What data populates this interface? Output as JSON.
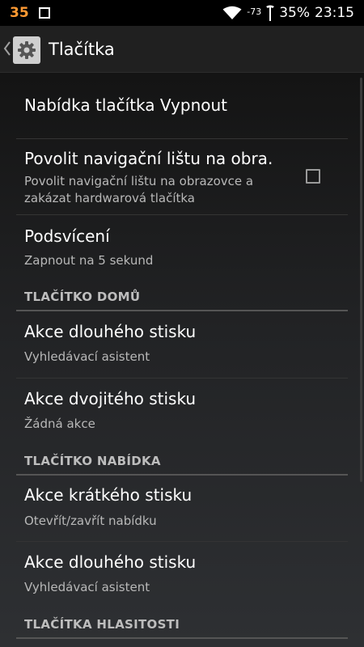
{
  "status_bar": {
    "notification_count": "35",
    "signal_strength": "-73",
    "battery": "35%",
    "time": "23:15"
  },
  "action_bar": {
    "title": "Tlačítka",
    "icon": "gear-icon"
  },
  "preferences": {
    "power_menu": {
      "title": "Nabídka tlačítka Vypnout"
    },
    "nav_bar": {
      "title": "Povolit navigační lištu na obra.",
      "summary_line1": "Povolit navigační lištu na obrazovce a",
      "summary_line2": "zakázat hardwarová tlačítka",
      "checked": false
    },
    "backlight": {
      "title": "Podsvícení",
      "summary": "Zapnout na 5 sekund"
    },
    "home_category": "TLAČÍTKO DOMŮ",
    "home_long": {
      "title": "Akce dlouhého stisku",
      "summary": "Vyhledávací asistent"
    },
    "home_double": {
      "title": "Akce dvojitého stisku",
      "summary": "Žádná akce"
    },
    "menu_category": "TLAČÍTKO NABÍDKA",
    "menu_short": {
      "title": "Akce krátkého stisku",
      "summary": "Otevřít/zavřít nabídku"
    },
    "menu_long": {
      "title": "Akce dlouhého stisku",
      "summary": "Vyhledávací asistent"
    },
    "volume_category": "TLAČÍTKA HLASITOSTI"
  }
}
